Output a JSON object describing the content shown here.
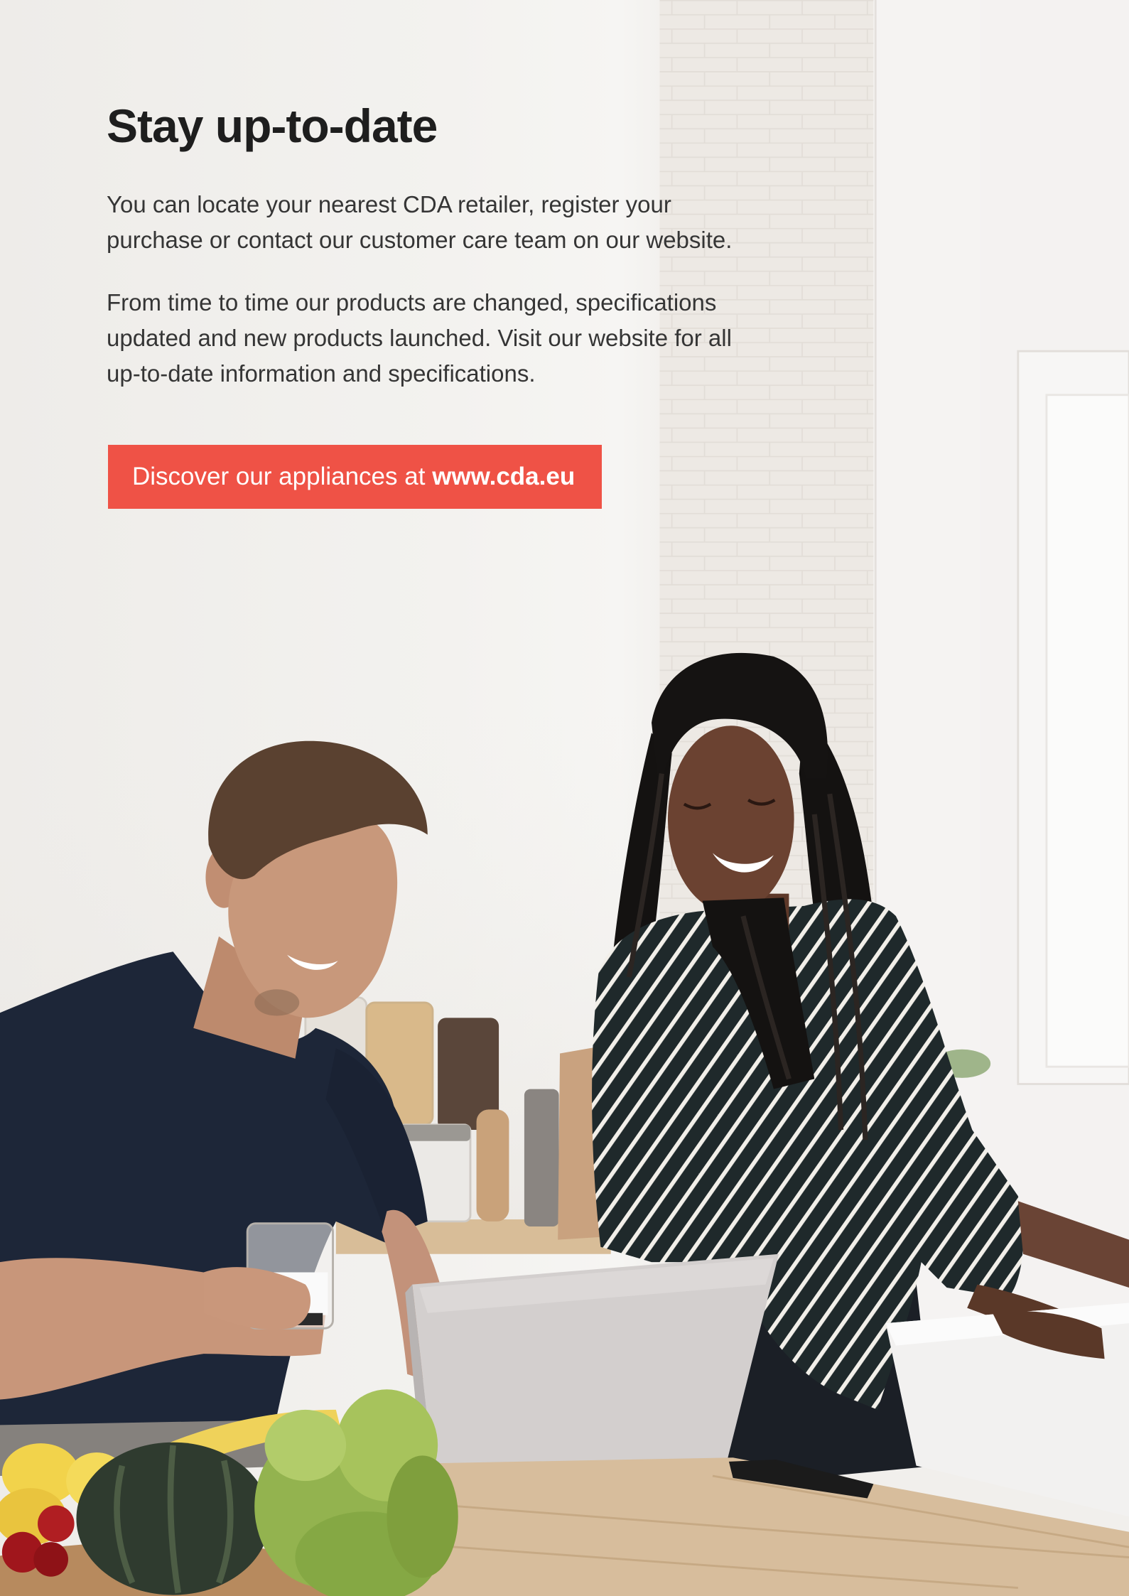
{
  "heading": "Stay up-to-date",
  "paragraphs": [
    "You can locate your nearest CDA retailer, register your purchase or contact our customer care team on our website.",
    "From time to time our products are changed, specifications updated and new products launched. Visit our website for all up-to-date information and specifications."
  ],
  "cta": {
    "prefix": "Discover our appliances at",
    "link": "www.cda.eu"
  },
  "colors": {
    "accent": "#ef5246",
    "heading": "#1e1e1e",
    "body_text": "#353535",
    "cta_text": "#ffffff"
  }
}
